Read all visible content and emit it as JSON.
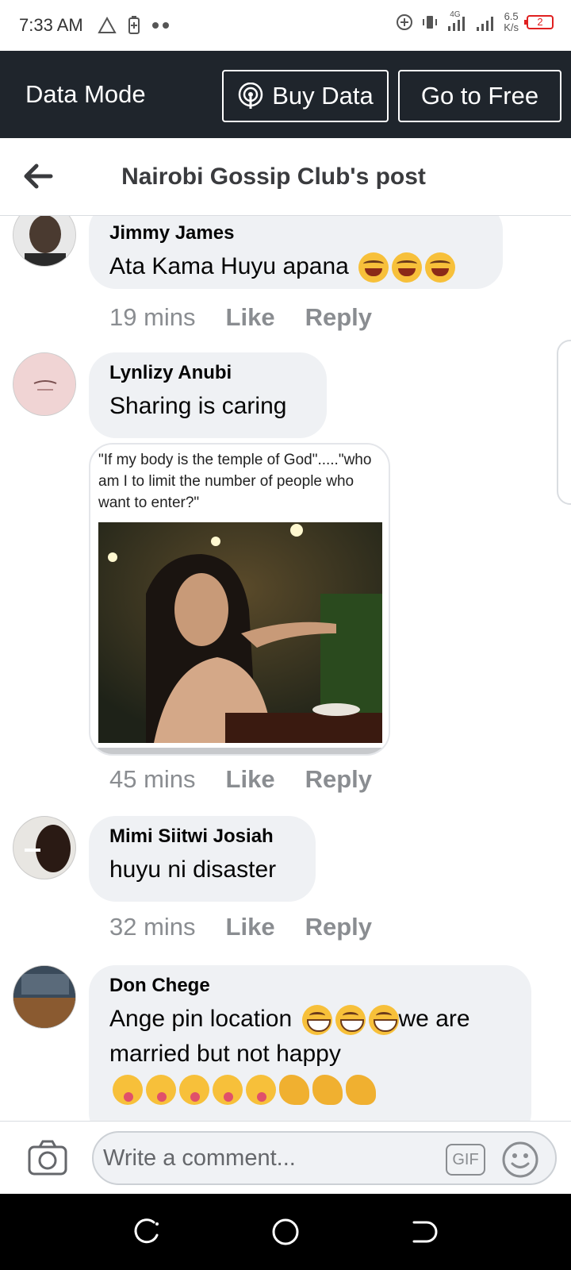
{
  "status_bar": {
    "time": "7:33 AM",
    "net_speed_value": "6.5",
    "net_speed_unit": "K/s",
    "network_label": "4G",
    "battery_level": "2"
  },
  "data_mode": {
    "title": "Data Mode",
    "buy_label": "Buy Data",
    "free_label": "Go to Free"
  },
  "header": {
    "title": "Nairobi Gossip Club's post"
  },
  "comments": [
    {
      "author": "Jimmy James",
      "text": "Ata Kama Huyu apana",
      "emojis": [
        "laugh-emoji",
        "laugh-emoji",
        "laugh-emoji"
      ],
      "time": "19 mins",
      "like": "Like",
      "reply": "Reply"
    },
    {
      "author": "Lynlizy Anubi",
      "text": "Sharing is caring",
      "attachment_caption": "\"If my body is the temple of God\".....\"who am I to limit the number of people who want to enter?\"",
      "time": "45 mins",
      "like": "Like",
      "reply": "Reply"
    },
    {
      "author": "Mimi Siitwi Josiah",
      "text": "huyu ni disaster",
      "time": "32 mins",
      "like": "Like",
      "reply": "Reply"
    },
    {
      "author": "Don Chege",
      "text_part1": "Ange pin location",
      "text_part2": "we are married but not happy",
      "emojis_inline": [
        "grin-emoji",
        "grin-emoji",
        "grin-emoji"
      ],
      "emojis_trailing": [
        "yum-emoji",
        "yum-emoji",
        "yum-emoji",
        "yum-emoji",
        "yum-emoji",
        "muscle-emoji",
        "muscle-emoji",
        "muscle-emoji"
      ]
    }
  ],
  "composer": {
    "placeholder": "Write a comment...",
    "gif_label": "GIF"
  },
  "colors": {
    "data_bar_bg": "#1f252c",
    "bubble_bg": "#eff1f4",
    "meta_text": "#8a8d91"
  }
}
